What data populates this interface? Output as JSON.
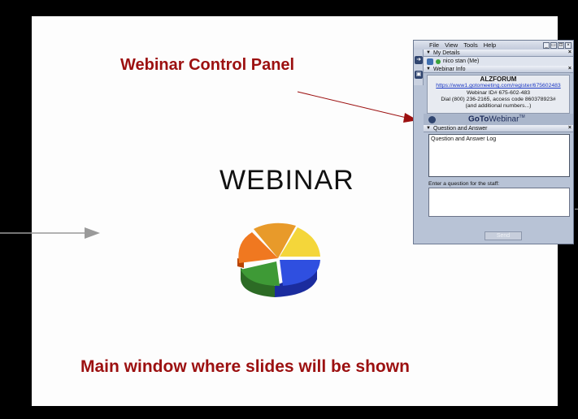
{
  "slide": {
    "callout_title": "Webinar Control Panel",
    "main_word": "WEBINAR",
    "main_caption": "Main window where slides will be shown"
  },
  "panel": {
    "menu": [
      "File",
      "View",
      "Tools",
      "Help"
    ],
    "window_buttons": [
      "_",
      "▭",
      "⊡",
      "×"
    ],
    "my_details": {
      "title": "My Details",
      "attendee": "nico stan (Me)"
    },
    "webinar_info": {
      "title": "Webinar Info",
      "organizer": "ALZFORUM",
      "link": "https://www1.gotomeeting.com/register/675602483",
      "webinar_id": "Webinar ID# 675-602-483",
      "dial": "Dial (800) 236-2165, access code 860378923#",
      "more": "(and additional numbers...)"
    },
    "brand": {
      "bold": "GoTo",
      "rest": "Webinar",
      "tm": "TM"
    },
    "qa": {
      "title": "Question and Answer",
      "log_text": "Question and Answer Log",
      "input_label": "Enter a question for the staff:",
      "input_value": "",
      "send_label": "Send"
    }
  },
  "colors": {
    "caption_red": "#9c1010",
    "panel_bg": "#b8c3d6",
    "link_blue": "#1b38c4"
  },
  "icons": [
    "microphone-icon",
    "status-dot-icon",
    "dock-arrow-icon",
    "dock-panel-icon",
    "gotowebinar-logo-icon",
    "pie-chart-graphic"
  ]
}
